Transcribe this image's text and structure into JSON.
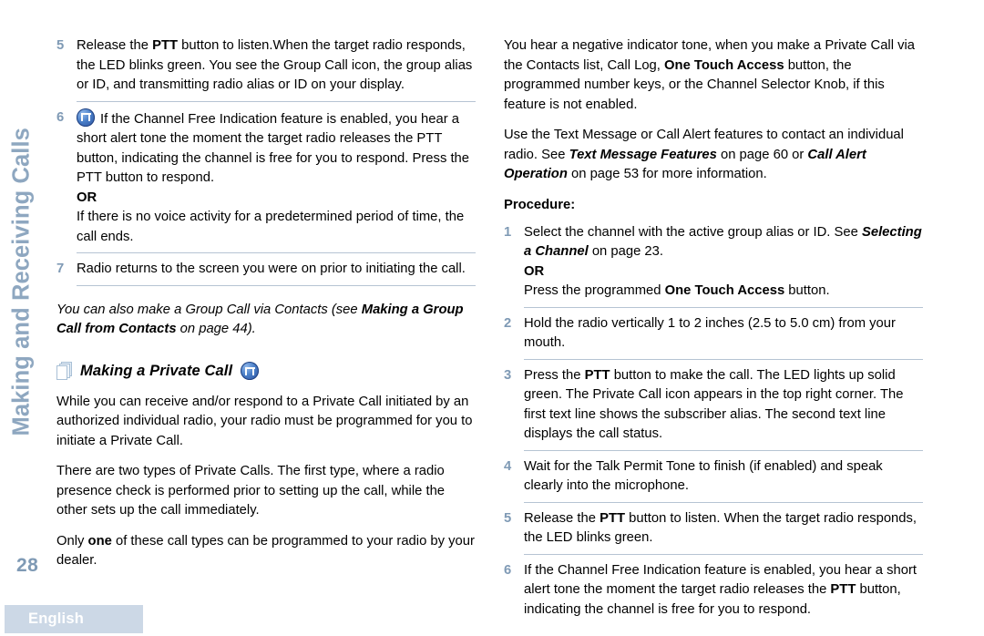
{
  "sidebar": {
    "chapter_title": "Making and Receiving Calls",
    "page_number": "28",
    "title_color": "#8ea7c0",
    "page_number_color": "#7f9ab5"
  },
  "footer": {
    "language_label": "English",
    "bar_color": "#ccd8e6",
    "label_color": "#ffffff"
  },
  "icons": {
    "pages_icon": "stacked-pages-icon",
    "tone_icon": "channel-free-tone-icon"
  },
  "left_column": {
    "steps": [
      {
        "number": "5",
        "text_parts": [
          {
            "t": "Release the ",
            "style": "normal"
          },
          {
            "t": "PTT",
            "style": "bold"
          },
          {
            "t": " button to listen.When the target radio responds, the LED blinks green. You see the Group Call icon, the group alias or ID, and transmitting radio alias or ID on your display.",
            "style": "normal"
          }
        ],
        "full_text": "Release the PTT button to listen.When the target radio responds, the LED blinks green. You see the Group Call icon, the group alias or ID, and transmitting radio alias or ID on your display."
      },
      {
        "number": "6",
        "has_icon": true,
        "full_text": "If the Channel Free Indication feature is enabled, you hear a short alert tone the moment the target radio releases the PTT button, indicating the channel is free for you to respond. Press the PTT button to respond.",
        "or_label": "OR",
        "or_text": "If there is no voice activity for a predetermined period of time, the call ends."
      },
      {
        "number": "7",
        "full_text": "Radio returns to the screen you were on prior to initiating the call."
      }
    ],
    "note": {
      "lead": "You can also make a Group Call via Contacts (see ",
      "bold_ref": "Making a Group Call from Contacts",
      "tail": " on page 44)."
    },
    "section_heading": "Making a Private Call",
    "paragraphs": [
      "While you can receive and/or respond to a Private Call initiated by an authorized individual radio, your radio must be programmed for you to initiate a Private Call.",
      "There are two types of Private Calls. The first type, where a radio presence check is performed prior to setting up the call, while the other sets up the call immediately.",
      "Only one of these call types can be programmed to your radio by your dealer."
    ],
    "paragraph3_bold_word": "one"
  },
  "right_column": {
    "paragraphs": [
      {
        "p1": "You hear a negative indicator tone, when you make a Private Call via the Contacts list, Call Log, ",
        "bold": "One Touch Access",
        "p2": " button, the programmed number keys, or the Channel Selector Knob, if this feature is not enabled."
      }
    ],
    "paragraph_two": {
      "lead": "Use the Text Message or Call Alert features to contact an individual radio. See ",
      "ref1": "Text Message Features",
      "mid": " on page 60 or ",
      "ref2": "Call Alert Operation",
      "tail": " on page 53 for more information."
    },
    "procedure_label": "Procedure:",
    "steps": [
      {
        "number": "1",
        "lead": "Select the channel with the active group alias or ID. See ",
        "ref": "Selecting a Channel",
        "tail": " on page 23.",
        "or_label": "OR",
        "or_lead": "Press the programmed ",
        "or_bold": "One Touch Access",
        "or_tail": " button."
      },
      {
        "number": "2",
        "full_text": "Hold the radio vertically 1 to 2 inches (2.5 to 5.0 cm) from your mouth."
      },
      {
        "number": "3",
        "lead": "Press the ",
        "bold": "PTT",
        "tail": " button to make the call. The LED lights up solid green. The Private Call icon appears in the top right corner. The first text line shows the subscriber alias. The second text line displays the call status."
      },
      {
        "number": "4",
        "full_text": "Wait for the Talk Permit Tone to finish (if enabled) and speak clearly into the microphone."
      },
      {
        "number": "5",
        "lead": "Release the ",
        "bold": "PTT",
        "tail": " button to listen. When the target radio responds, the LED blinks green."
      },
      {
        "number": "6",
        "lead": "If the Channel Free Indication feature is enabled, you hear a short alert tone the moment the target radio releases the ",
        "bold": "PTT",
        "tail": " button, indicating the channel is free for you to respond."
      }
    ]
  }
}
